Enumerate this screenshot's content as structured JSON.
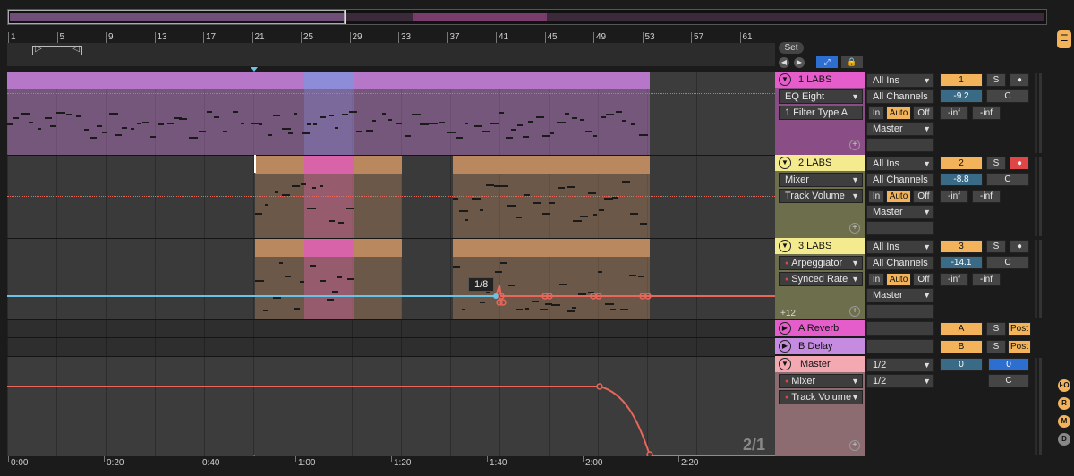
{
  "ruler": {
    "bars": [
      "1",
      "5",
      "9",
      "13",
      "17",
      "21",
      "25",
      "29",
      "33",
      "37",
      "41",
      "45",
      "49",
      "53",
      "57",
      "61"
    ]
  },
  "time_ruler": {
    "labels": [
      "0:00",
      "0:20",
      "0:40",
      "1:00",
      "1:20",
      "1:40",
      "2:00",
      "2:20"
    ]
  },
  "arrangement": {
    "zoom_label": "2/1",
    "tooltip": "1/8",
    "track3_offset": "+12"
  },
  "header_controls": {
    "set_label": "Set"
  },
  "tracks": [
    {
      "id": "t1",
      "title": "1 LABS",
      "color": "#e45dcb",
      "device": "EQ Eight",
      "param": "1 Filter Type A",
      "input": "All Ins",
      "channel": "All Channels",
      "monitor": [
        "In",
        "Auto",
        "Off"
      ],
      "output": "Master",
      "number": "1",
      "solo": "S",
      "volume": "-9.2",
      "pan": "C",
      "peak_left": "-inf",
      "peak_right": "-inf"
    },
    {
      "id": "t2",
      "title": "2 LABS",
      "color": "#f4ea8e",
      "device": "Mixer",
      "param": "Track Volume",
      "input": "All Ins",
      "channel": "All Channels",
      "monitor": [
        "In",
        "Auto",
        "Off"
      ],
      "output": "Master",
      "number": "2",
      "solo": "S",
      "volume": "-8.8",
      "pan": "C",
      "peak_left": "-inf",
      "peak_right": "-inf"
    },
    {
      "id": "t3",
      "title": "3 LABS",
      "color": "#f4ea8e",
      "device": "Arpeggiator",
      "param": "Synced Rate",
      "input": "All Ins",
      "channel": "All Channels",
      "monitor": [
        "In",
        "Auto",
        "Off"
      ],
      "output": "Master",
      "number": "3",
      "solo": "S",
      "volume": "-14.1",
      "pan": "C",
      "peak_left": "-inf",
      "peak_right": "-inf"
    }
  ],
  "returns": [
    {
      "title": "A Reverb",
      "color": "#e45dcb",
      "number": "A",
      "solo": "S",
      "post": "Post"
    },
    {
      "title": "B Delay",
      "color": "#c58be0",
      "number": "B",
      "solo": "S",
      "post": "Post"
    }
  ],
  "master": {
    "title": "Master",
    "color": "#f4a8b2",
    "device": "Mixer",
    "param": "Track Volume",
    "cue": "1/2",
    "out": "1/2",
    "vol_left": "0",
    "vol_right": "0",
    "pan": "C"
  },
  "sidebar": {
    "io": "I·O",
    "r": "R",
    "m": "M",
    "d": "D"
  },
  "colors": {
    "accent": "#f2b35a",
    "automation": "#e9665a",
    "automation_cyan": "#68c3e6",
    "clip_purple": "#b777c8",
    "clip_brown": "#b9885e",
    "clip_pink": "#d863a8",
    "clip_blue": "#8c8cd8"
  }
}
